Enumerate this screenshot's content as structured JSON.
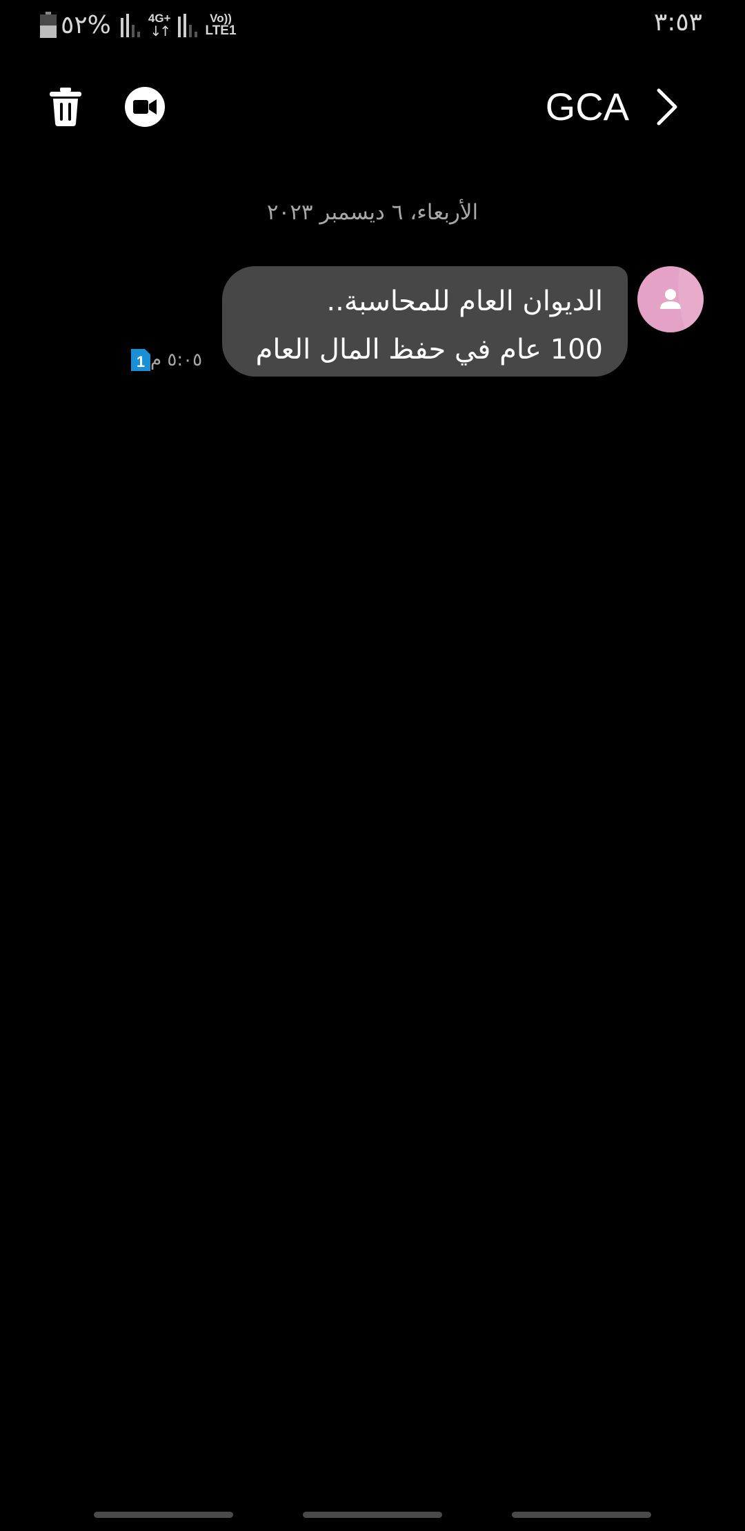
{
  "status_bar": {
    "time": "٣:٥٣",
    "battery_text": "%٥٢",
    "battery_level": 0.52,
    "network_type": "4G+",
    "volte_top": "Vo))",
    "volte_bottom": "LTE1"
  },
  "app_bar": {
    "contact_name": "GCA",
    "icons": {
      "delete": "trash-icon",
      "video_call": "video-call-icon",
      "back": "chevron-right-icon"
    }
  },
  "conversation": {
    "date_divider": "الأربعاء، ٦ ديسمبر ٢٠٢٣",
    "messages": [
      {
        "lines": [
          "الديوان العام للمحاسبة..",
          "100 عام في حفظ المال العام"
        ],
        "time": "٥:٠٥ م",
        "sim": "1"
      }
    ]
  },
  "colors": {
    "background": "#000000",
    "bubble": "#474747",
    "avatar": "#e4a2c6",
    "sim_badge": "#1a8fd6",
    "secondary_text": "#a8a8a8"
  }
}
